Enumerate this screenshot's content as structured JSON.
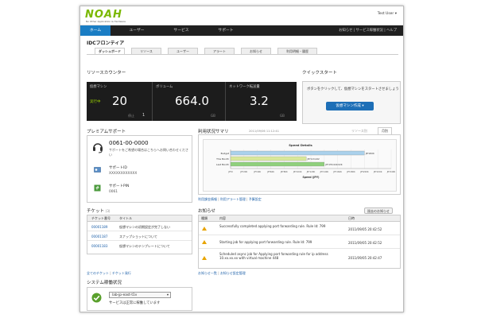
{
  "brand": {
    "logo": "NOAH",
    "tagline": "No Other Application & Hardware"
  },
  "user_menu": "Test User",
  "nav": {
    "tabs": [
      {
        "label": "ホーム"
      },
      {
        "label": "ユーザー"
      },
      {
        "label": "サービス"
      },
      {
        "label": "サポート"
      }
    ],
    "links": "お知らせ | サービス稼働状況 | ヘルプ"
  },
  "page_title": "IDCフロンティア",
  "subtabs": [
    "ダッシュボード",
    "リソース",
    "ユーザー",
    "アラート",
    "お知らせ",
    "利用明細・履歴"
  ],
  "resource_counter": {
    "title": "リソースカウンター",
    "vm": {
      "label": "仮想マシン",
      "status": "実行中",
      "value": "20",
      "sub_label": "停止",
      "sub_value": "1"
    },
    "volume": {
      "label": "ボリューム",
      "value": "664.0",
      "unit": "GB"
    },
    "network": {
      "label": "ネットワーク転送量",
      "value": "3.2",
      "unit": "GB"
    }
  },
  "quick_start": {
    "title": "クイックスタート",
    "text": "ボタンをクリックして、仮想マシンをスタートさせましょう",
    "button": "仮想マシン作成 ▾"
  },
  "premium_support": {
    "title": "プレミアムサポート",
    "phone": "0061-00-0000",
    "phone_note": "サポートをご希望の場合はこちらへお問い合わせください",
    "id_label": "サポートID",
    "id_value": "XXXXXXXXXXXX",
    "pin_label": "サポートPIN",
    "pin_value": "0061"
  },
  "usage_summary": {
    "title": "利用状況サマリ",
    "date": "2011/09/06 11:12:41",
    "tabs": [
      "リソース別",
      "月別"
    ],
    "links": [
      "利用課金情報",
      "利用アラート管理",
      "予算設定"
    ]
  },
  "chart_data": {
    "type": "bar",
    "title": "Speed Details",
    "xlabel": "Speed (JPY)",
    "ylabel": "",
    "categories": [
      "Budget",
      "This Month",
      "Last Month"
    ],
    "values": [
      200000,
      113022,
      140001
    ],
    "data_labels": [
      "JPY200K",
      "JPY113,022",
      "JPY155,940.02K"
    ],
    "colors": [
      "#aad1ec",
      "#d9e89a",
      "#8fd07c"
    ],
    "x_ticks": [
      "JPY0",
      "JPY20K",
      "JPY40K",
      "JPY60K",
      "JPY80K",
      "JPY100K",
      "JPY120K",
      "JPY140K",
      "JPY160K",
      "JPY180K",
      "JPY200K",
      "JPY220K",
      "JPY240K"
    ],
    "xlim": [
      0,
      240000
    ],
    "grid": true
  },
  "tickets": {
    "title": "チケット",
    "count": "(3)",
    "headers": [
      "チケット番号",
      "タイトル"
    ],
    "rows": [
      {
        "id": "00001189",
        "title": "仮想マシンの初期設定が完了しない"
      },
      {
        "id": "00001187",
        "title": "スナップショットについて"
      },
      {
        "id": "00001183",
        "title": "仮想マシンのテンプレートについて"
      }
    ],
    "links": [
      "全てのチケット",
      "チケット発行"
    ]
  },
  "news": {
    "title": "お知らせ",
    "archive": "過去のお知らせ",
    "headers": [
      "種類",
      "内容",
      "日時"
    ],
    "rows": [
      {
        "text": "Successfully completed applying port forwarding rule. Rule Id: 799",
        "date": "2011/09/05 20:42:52"
      },
      {
        "text": "Starting job for applying port forwarding rule. Rule Id: 799",
        "date": "2011/09/05 20:42:52"
      },
      {
        "text": "Scheduled async job for Applying port forwarding rule for ip address 10.xx.xx.xx with virtual machine 448",
        "date": "2011/09/05 20:42:47"
      }
    ],
    "links": [
      "お知らせ一覧",
      "お知らせ設定管理"
    ]
  },
  "system_status": {
    "title": "システム稼働状況",
    "zone": "lab-jp-east-t1v",
    "message": "サービスは正常に稼働しています"
  }
}
